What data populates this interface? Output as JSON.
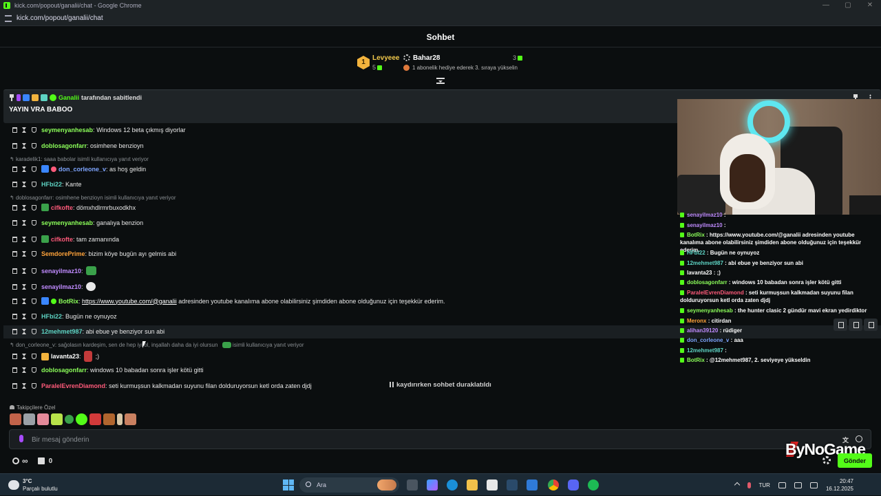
{
  "window": {
    "title": "kick.com/popout/ganalii/chat - Google Chrome",
    "url": "kick.com/popout/ganalii/chat"
  },
  "header": {
    "title": "Sohbet"
  },
  "leaderboard": {
    "first": {
      "rank": "1",
      "name": "Levyeee",
      "count": "5"
    },
    "second": {
      "name": "Bahar28",
      "count": "3",
      "note": "1 abonelik hediye ederek 3. sıraya yükselin"
    }
  },
  "pinned": {
    "author": "Ganalii",
    "suffix": "tarafından sabitlendi",
    "message": "YAYIN VRA BABOO"
  },
  "messages": [
    {
      "user": "seymenyanhesab",
      "color": "#8cff5a",
      "text": "Windows 12 beta çıkmış diyorlar"
    },
    {
      "user": "doblosagonfarr",
      "color": "#8cff5a",
      "text": "osimhene benzioyn"
    },
    {
      "user": "don_corleone_v",
      "color": "#7fa6ff",
      "text": "as hoş geldin"
    },
    {
      "user": "HFbi22",
      "color": "#5ed4c4",
      "text": "Kante"
    },
    {
      "user": "cifkofte",
      "color": "#ff5a7a",
      "text": "dömxhdlrmrbuxodkhx"
    },
    {
      "user": "seymenyanhesab",
      "color": "#8cff5a",
      "text": "ganalıya benzion"
    },
    {
      "user": "cifkofte",
      "color": "#ff5a7a",
      "text": "tam zamanında"
    },
    {
      "user": "SemdorePrime",
      "color": "#ffa33a",
      "text": "bizim köye bugün ayı gelmis abi"
    },
    {
      "user": "senayilmaz10",
      "color": "#c08bff",
      "text": ""
    },
    {
      "user": "senayilmaz10",
      "color": "#c08bff",
      "text": ""
    },
    {
      "user": "BotRix",
      "color": "#8cff5a",
      "text": "https://www.youtube.com/@ganalii",
      "tail": "adresinden youtube kanalıma abone olabilirsiniz şimdiden abone olduğunuz için teşekkür ederim."
    },
    {
      "user": "HFbi22",
      "color": "#5ed4c4",
      "text": "Bugün ne oynuyoz"
    },
    {
      "user": "12mehmet987",
      "color": "#5ed4c4",
      "text": "abi ebue ye benziyor sun abi"
    },
    {
      "user": "lavanta23",
      "color": "#ffffff",
      "text": ";)"
    },
    {
      "user": "doblosagonfarr",
      "color": "#8cff5a",
      "text": "windows 10 babadan sonra işler kötü gitti"
    },
    {
      "user": "ParalelEvrenDiamond",
      "color": "#ff5a7a",
      "text": "seti kurmuşsun kalkmadan suyunu filan dolduruyorsun ketl orda zaten djdj"
    }
  ],
  "replies": {
    "r1": "karadelik1: saaa babolar isimli kullanıcıya yanıt veriyor",
    "r2": "doblosagonfarr: osimhene benzioyn isimli kullanıcıya yanıt veriyor",
    "r3": "don_corleone_v: sağolasın kardeşim, sen de hep iyi ol, inşallah daha da iyi olursun",
    "r3tail": "isimli kullanıcıya yanıt veriyor"
  },
  "paused": "kaydırırken sohbet duraklatıldı",
  "overlay": [
    {
      "user": "senayilmaz10",
      "color": "#c08bff",
      "text": ":"
    },
    {
      "user": "senayilmaz10",
      "color": "#c08bff",
      "text": ":"
    },
    {
      "user": "BotRix",
      "color": "#8cff5a",
      "text": ": https://www.youtube.com/@ganalii adresinden youtube kanalıma abone olabilirsiniz şimdiden abone olduğunuz için teşekkür ederim."
    },
    {
      "user": "HFbi22",
      "color": "#5ed4c4",
      "text": ": Bugün ne oynuyoz"
    },
    {
      "user": "12mehmet987",
      "color": "#5ed4c4",
      "text": ": abi ebue ye benziyor sun abi"
    },
    {
      "user": "lavanta23",
      "color": "#ffffff",
      "text": ": ;)"
    },
    {
      "user": "doblosagonfarr",
      "color": "#8cff5a",
      "text": ": windows 10 babadan sonra işler kötü gitti"
    },
    {
      "user": "ParalelEvrenDiamond",
      "color": "#ff5a7a",
      "text": ": seti kurmuşsun kalkmadan suyunu filan dolduruyorsun ketl orda zaten djdj"
    },
    {
      "user": "seymenyanhesab",
      "color": "#8cff5a",
      "text": ": the hunter clasic 2 gündür mavi ekran yedirdiktor"
    },
    {
      "user": "Meronx",
      "color": "#ffa33a",
      "text": ": citirdan"
    },
    {
      "user": "alihan39120",
      "color": "#c08bff",
      "text": ": rüdiger"
    },
    {
      "user": "don_corleone_v",
      "color": "#7fa6ff",
      "text": ": aaa"
    },
    {
      "user": "12mehmet987",
      "color": "#5ed4c4",
      "text": ":"
    },
    {
      "user": "BotRix",
      "color": "#8cff5a",
      "text": ": @12mehmet987, 2. seviyeye yükseldin"
    }
  ],
  "followers_label": "Takipçilere Özel",
  "input": {
    "placeholder": "Bir mesaj gönderin"
  },
  "bottom": {
    "infinity": "∞",
    "box_count": "0",
    "send": "Gönder"
  },
  "brand": "ByNoGame",
  "taskbar": {
    "temp": "3°C",
    "weather": "Parçalı bulutlu",
    "search": "Ara",
    "lang": "TUR",
    "time": "20:47",
    "date": "16.12.2025"
  },
  "colors": {
    "accent": "#53fc18",
    "bg": "#0b0e0f"
  }
}
